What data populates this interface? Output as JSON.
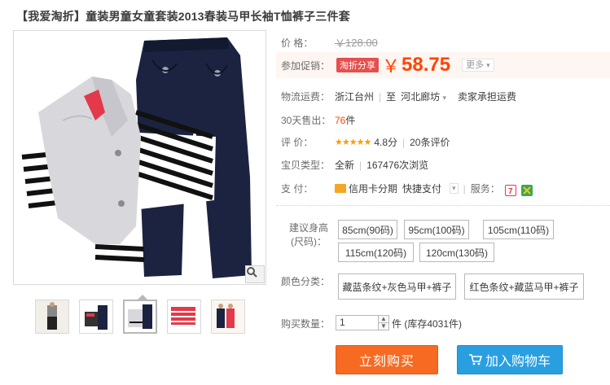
{
  "title": "【我爱淘折】童装男童女童套装2013春装马甲长袖T恤裤子三件套",
  "price": {
    "label": "价 格：",
    "currency": "￥",
    "original": "128.00"
  },
  "promo": {
    "label": "参加促销：",
    "badge": "淘折分享",
    "currency": "￥",
    "price": "58.75",
    "more": "更多",
    "more_arrow": "▾"
  },
  "shipping": {
    "label": "物流运费：",
    "from": "浙江台州",
    "to_label": "至",
    "to": "河北廊坊",
    "to_arrow": "▾",
    "note": "卖家承担运费"
  },
  "sold": {
    "label": "30天售出：",
    "count": "76",
    "unit": "件"
  },
  "rating": {
    "label": "评 价：",
    "stars": "★★★★★",
    "score": "4.8分",
    "reviews": "20条评价"
  },
  "type": {
    "label": "宝贝类型：",
    "condition": "全新",
    "views": "167476次浏览"
  },
  "payment": {
    "label": "支 付：",
    "installment": "信用卡分期",
    "quickpay": "快捷支付",
    "service_label": "服务："
  },
  "size": {
    "label_line1": "建议身高",
    "label_line2": "(尺码)：",
    "options": [
      "85cm(90码)",
      "95cm(100码)",
      "105cm(110码)",
      "115cm(120码)",
      "120cm(130码)"
    ]
  },
  "color": {
    "label": "颜色分类：",
    "options": [
      "藏蓝条纹+灰色马甲+裤子",
      "红色条纹+藏蓝马甲+裤子"
    ]
  },
  "quantity": {
    "label": "购买数量：",
    "value": "1",
    "up": "▲",
    "down": "▼",
    "stock": "件 (库存4031件)"
  },
  "actions": {
    "buy": "立刻购买",
    "cart": "加入购物车"
  },
  "colors": {
    "accent": "#ff4400",
    "buy_button": "#f66a22",
    "cart_button": "#2a9fe0",
    "navy": "#1c2340",
    "vest_gray": "#d8d8dc"
  },
  "icons": {
    "zoom": "magnifier-icon",
    "installment": "credit-card-icon",
    "cart": "shopping-cart-icon"
  }
}
